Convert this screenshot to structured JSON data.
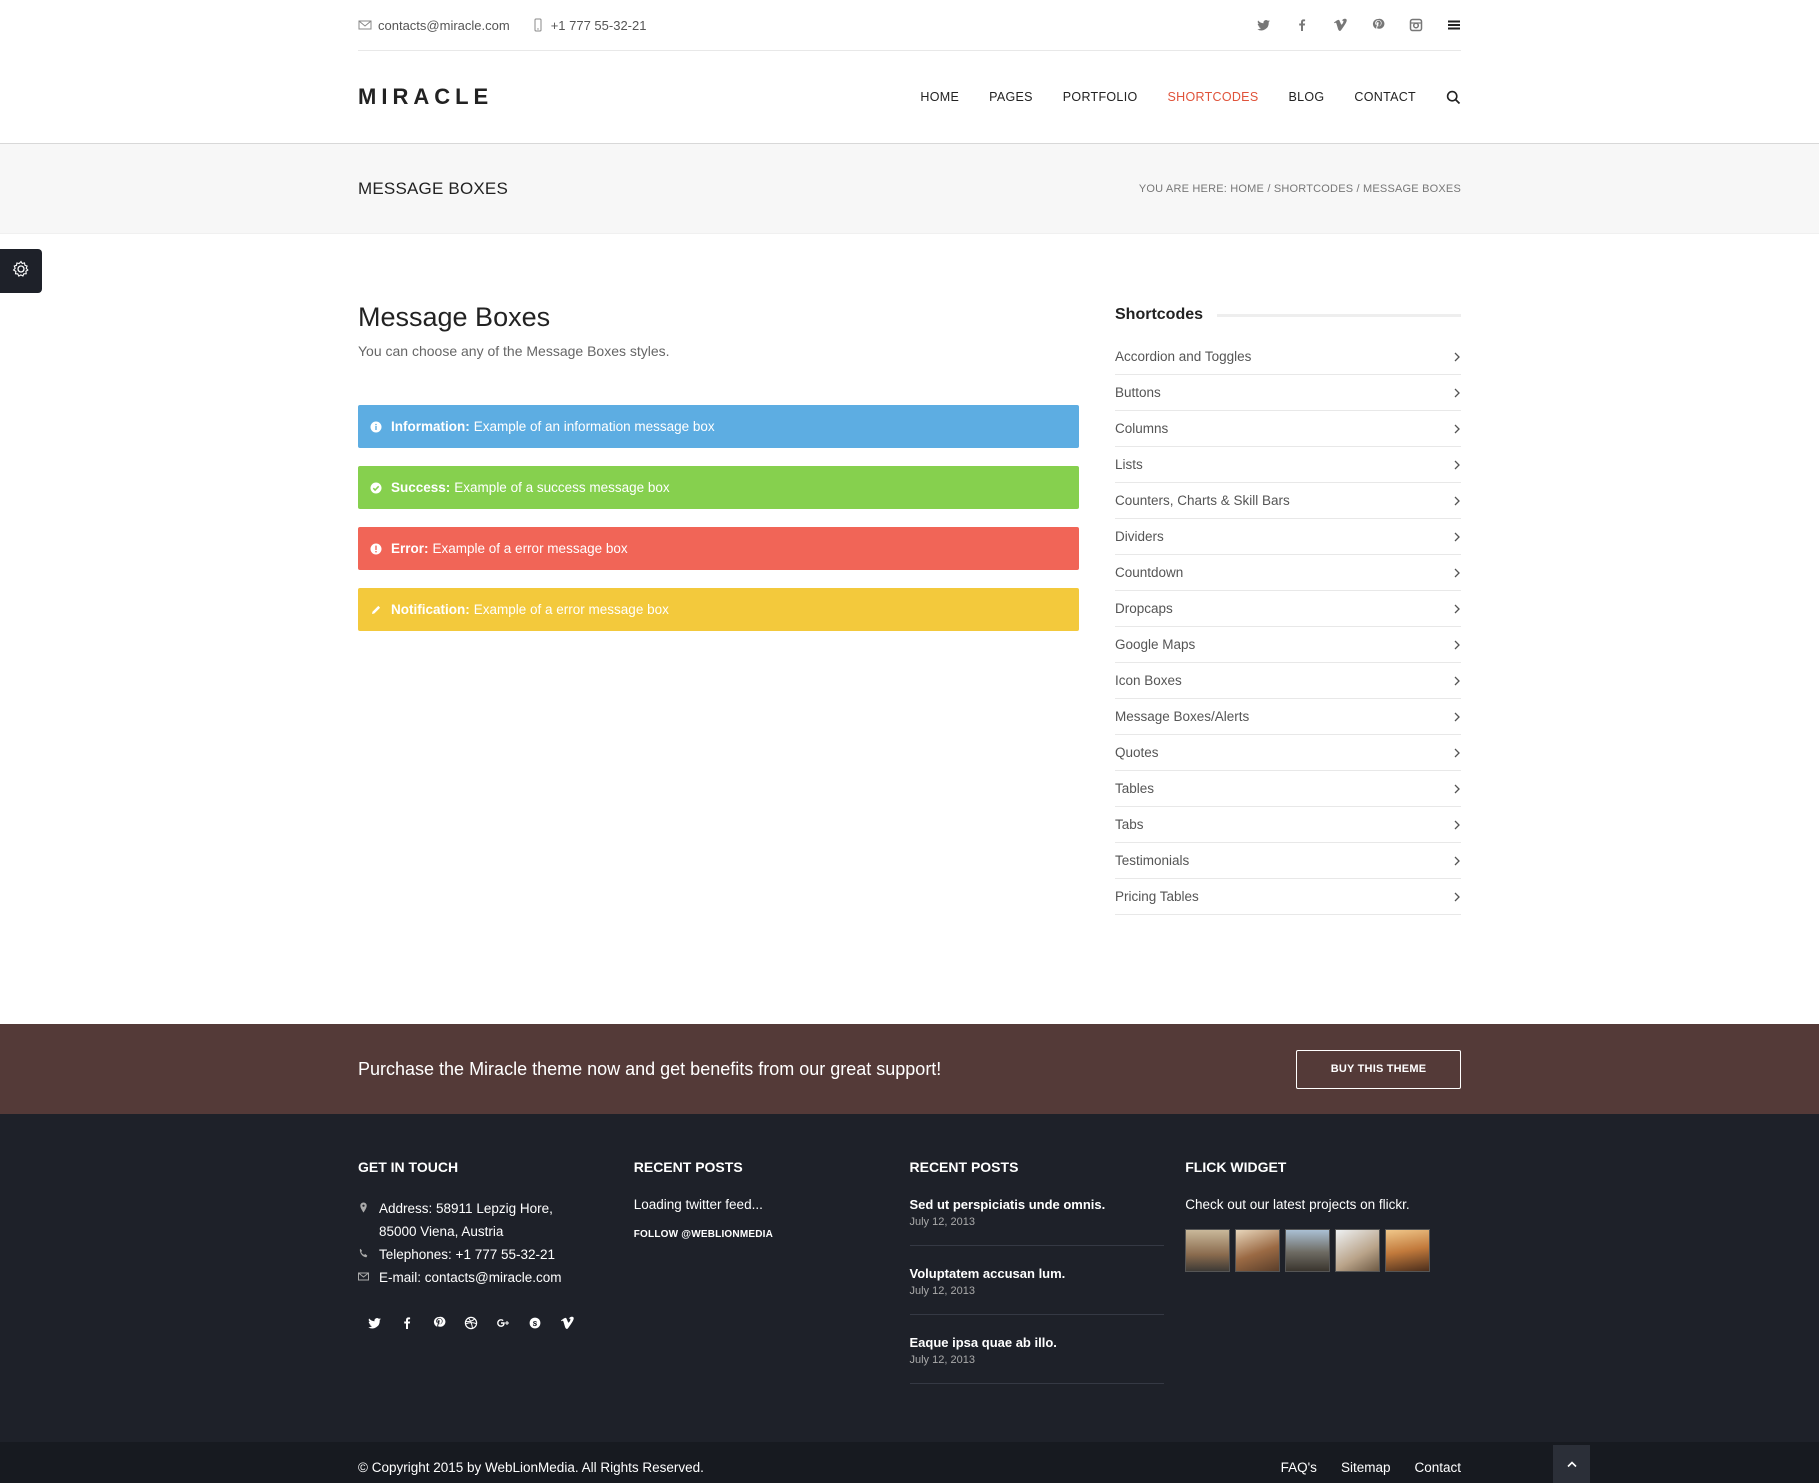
{
  "topbar": {
    "email": "contacts@miracle.com",
    "phone": "+1 777 55-32-21",
    "social": [
      "twitter-icon",
      "facebook-icon",
      "vimeo-icon",
      "pinterest-icon",
      "instagram-icon"
    ]
  },
  "header": {
    "logo": "MIRACLE",
    "nav": [
      "HOME",
      "PAGES",
      "PORTFOLIO",
      "SHORTCODES",
      "BLOG",
      "CONTACT"
    ],
    "active_nav": "SHORTCODES",
    "accent_color": "#e0533a"
  },
  "titlebar": {
    "title": "MESSAGE BOXES",
    "breadcrumb": "YOU ARE HERE: HOME / SHORTCODES / MESSAGE BOXES"
  },
  "content": {
    "title": "Message Boxes",
    "lead": "You can choose any of the Message Boxes styles.",
    "messages": [
      {
        "label": "Information:",
        "text": "Example of an information message box",
        "color": "#5dade2",
        "icon": "info-icon"
      },
      {
        "label": "Success:",
        "text": "Example of a success message box",
        "color": "#86d04e",
        "icon": "check-icon"
      },
      {
        "label": "Error:",
        "text": "Example of a error message box",
        "color": "#f16557",
        "icon": "error-icon"
      },
      {
        "label": "Notification:",
        "text": "Example of a error message box",
        "color": "#f3c93c",
        "icon": "pencil-icon"
      }
    ]
  },
  "sidebar": {
    "title": "Shortcodes",
    "items": [
      "Accordion and Toggles",
      "Buttons",
      "Columns",
      "Lists",
      "Counters, Charts & Skill Bars",
      "Dividers",
      "Countdown",
      "Dropcaps",
      "Google Maps",
      "Icon Boxes",
      "Message Boxes/Alerts",
      "Quotes",
      "Tables",
      "Tabs",
      "Testimonials",
      "Pricing Tables"
    ]
  },
  "cta": {
    "text": "Purchase the Miracle theme now and get benefits from our great support!",
    "button": "BUY THIS THEME"
  },
  "footer": {
    "get_in_touch": {
      "title": "GET IN TOUCH",
      "address_1": "Address: 58911 Lepzig Hore,",
      "address_2": "85000 Viena, Austria",
      "phone": "Telephones: +1 777 55-32-21",
      "email": "E-mail: contacts@miracle.com",
      "social": [
        "twitter-icon",
        "facebook-icon",
        "pinterest-icon",
        "dribbble-icon",
        "google-plus-icon",
        "skype-icon",
        "vimeo-icon"
      ]
    },
    "twitter": {
      "title": "RECENT POSTS",
      "loading": "Loading twitter feed...",
      "follow": "FOLLOW @WEBLIONMEDIA"
    },
    "recent_posts": {
      "title": "RECENT POSTS",
      "posts": [
        {
          "title": "Sed ut perspiciatis unde omnis.",
          "date": "July 12, 2013"
        },
        {
          "title": "Voluptatem accusan lum.",
          "date": "July 12, 2013"
        },
        {
          "title": "Eaque ipsa quae ab illo.",
          "date": "July 12, 2013"
        }
      ]
    },
    "flickr": {
      "title": "FLICK WIDGET",
      "text": "Check out our latest projects on flickr."
    },
    "copyright": "© Copyright 2015 by WebLionMedia. All Rights Reserved.",
    "links": [
      "FAQ's",
      "Sitemap",
      "Contact"
    ]
  }
}
